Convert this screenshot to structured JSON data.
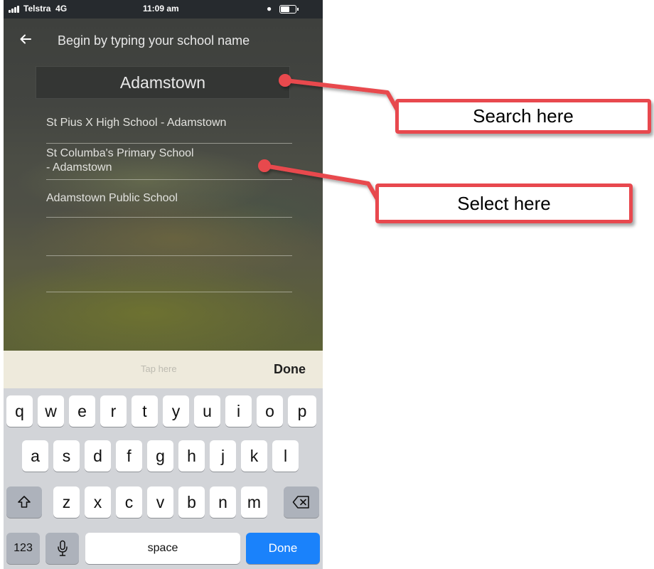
{
  "status_bar": {
    "carrier": "Telstra",
    "network": "4G",
    "time": "11:09 am"
  },
  "header": {
    "title": "Begin by typing your school name",
    "back_icon": "arrow-left-icon"
  },
  "search": {
    "value": "Adamstown"
  },
  "results": [
    "St Pius X High School - Adamstown",
    "St Columba's Primary School - Adamstown",
    "Adamstown Public School",
    "",
    ""
  ],
  "results_lines": [
    [
      "St Pius X High School - Adamstown"
    ],
    [
      "St Columba's Primary School",
      "- Adamstown"
    ],
    [
      "Adamstown Public School"
    ]
  ],
  "keyboard_toolbar": {
    "hint": "Tap here",
    "done": "Done"
  },
  "keyboard": {
    "row1": [
      "q",
      "w",
      "e",
      "r",
      "t",
      "y",
      "u",
      "i",
      "o",
      "p"
    ],
    "row2": [
      "a",
      "s",
      "d",
      "f",
      "g",
      "h",
      "j",
      "k",
      "l"
    ],
    "row3": [
      "z",
      "x",
      "c",
      "v",
      "b",
      "n",
      "m"
    ],
    "numbers_key": "123",
    "space_key": "space",
    "done_key": "Done",
    "shift_icon": "shift-icon",
    "backspace_icon": "backspace-icon",
    "mic_icon": "microphone-icon"
  },
  "callouts": {
    "search": "Search here",
    "select": "Select here",
    "color": "#e8484e"
  }
}
